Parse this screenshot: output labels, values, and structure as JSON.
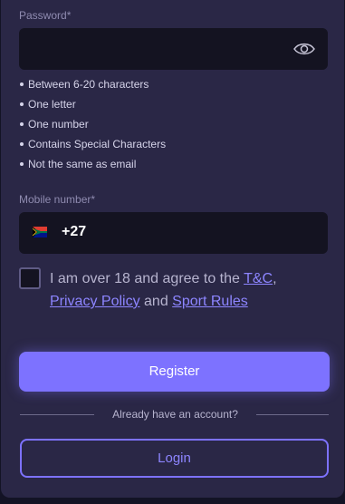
{
  "password": {
    "label": "Password*",
    "value": "",
    "rules": [
      "Between 6-20 characters",
      "One letter",
      "One number",
      "Contains Special Characters",
      "Not the same as email"
    ]
  },
  "mobile": {
    "label": "Mobile number*",
    "dial_code": "+27",
    "flag_icon": "south-africa-flag-icon"
  },
  "consent": {
    "prefix": "I am over 18 and agree to the ",
    "tc_link": "T&C",
    "comma": ",",
    "privacy_link": "Privacy Policy",
    "and_text": " and ",
    "sport_rules_link": "Sport Rules",
    "checked": false
  },
  "actions": {
    "register_label": "Register",
    "account_prompt": "Already have an account?",
    "login_label": "Login"
  },
  "colors": {
    "accent": "#7d72ff",
    "panel": "#2a2746",
    "input": "#141321"
  }
}
